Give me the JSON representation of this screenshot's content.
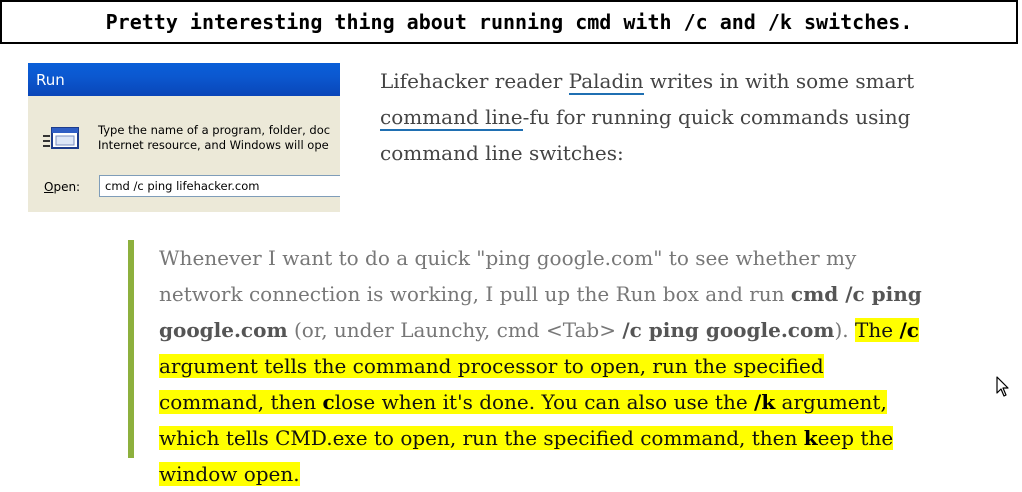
{
  "title": "Pretty interesting thing about running cmd with /c and /k switches.",
  "run_dialog": {
    "title": "Run",
    "desc_line1": "Type the name of a program, folder, doc",
    "desc_line2": "Internet resource, and Windows will ope",
    "open_label_prefix": "O",
    "open_label_rest": "pen:",
    "command": "cmd /c ping lifehacker.com"
  },
  "intro": {
    "t1": "Lifehacker reader ",
    "link1": "Paladin",
    "t2": " writes in with some smart ",
    "link2": "command line",
    "t3": "-fu for running quick commands using command line switches:"
  },
  "quote": {
    "q1": "Whenever I want to do a quick \"ping google.com\" to see whether my network connection is working, I pull up the Run box and run ",
    "b1": "cmd /c ping google.com",
    "q2": " (or, under Launchy, cmd <Tab> ",
    "b2": "/c ping google.com",
    "q3": "). ",
    "h1": "The ",
    "hb1": "/c",
    "h2": " argument tells the command processor to open, run the specified command, then ",
    "hb2": "c",
    "h3": "lose when it's done. You can also use the ",
    "hb3": "/k",
    "h4": " argument, which tells CMD.exe to open, run the specified command, then ",
    "hb4": "k",
    "h5": "eep the window open."
  },
  "colors": {
    "quote_border": "#8db03d",
    "highlight": "#ffff00",
    "link_underline": "#1f6fb2",
    "xp_titlebar": "#0a5fd8"
  },
  "icons": [
    "run-program-icon",
    "mouse-cursor-icon"
  ]
}
